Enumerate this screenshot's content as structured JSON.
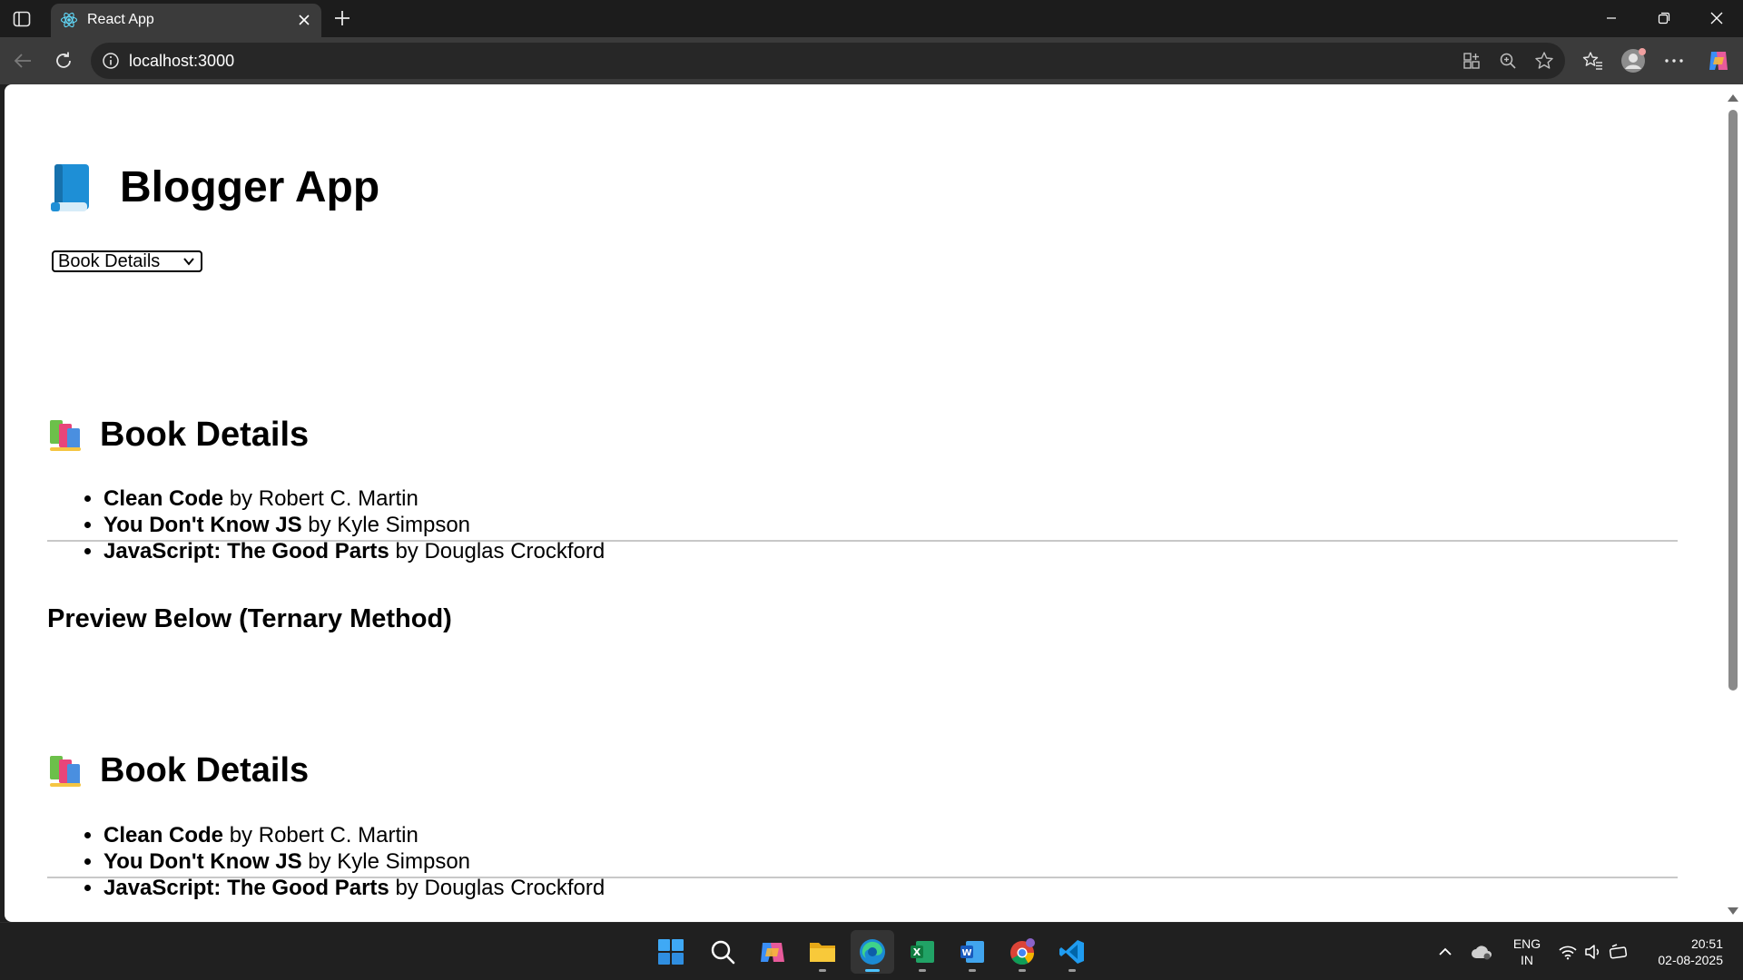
{
  "browser": {
    "tab": {
      "title": "React App"
    },
    "address_bar": {
      "url": "localhost:3000"
    }
  },
  "page": {
    "app_title": "Blogger App",
    "view_select": {
      "selected": "Book Details"
    },
    "book_section": {
      "title": "Book Details",
      "books": [
        {
          "title": "Clean Code",
          "by": "by",
          "author": "Robert C. Martin"
        },
        {
          "title": "You Don't Know JS",
          "by": "by",
          "author": "Kyle Simpson"
        },
        {
          "title": "JavaScript: The Good Parts",
          "by": "by",
          "author": "Douglas Crockford"
        }
      ]
    },
    "preview": {
      "heading": "Preview Below (Ternary Method)",
      "section_title": "Book Details",
      "books": [
        {
          "title": "Clean Code",
          "by": "by",
          "author": "Robert C. Martin"
        },
        {
          "title": "You Don't Know JS",
          "by": "by",
          "author": "Kyle Simpson"
        },
        {
          "title": "JavaScript: The Good Parts",
          "by": "by",
          "author": "Douglas Crockford"
        }
      ]
    }
  },
  "taskbar": {
    "apps": [
      "start-icon",
      "search-icon",
      "copilot-icon",
      "file-explorer-icon",
      "edge-icon",
      "excel-icon",
      "word-icon",
      "chrome-icon",
      "vscode-icon"
    ],
    "language": {
      "line1": "ENG",
      "line2": "IN"
    },
    "time": "20:51",
    "date": "02-08-2025"
  }
}
